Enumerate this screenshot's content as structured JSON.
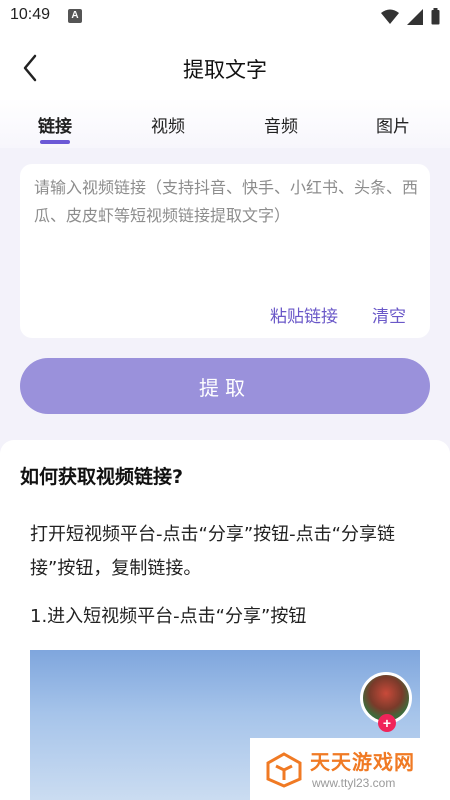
{
  "status_bar": {
    "time": "10:49",
    "notification_badge": "A",
    "icons": [
      "wifi-icon",
      "signal-icon",
      "battery-icon"
    ]
  },
  "header": {
    "title": "提取文字",
    "back_icon": "chevron-left-icon"
  },
  "tabs": [
    {
      "label": "链接",
      "active": true
    },
    {
      "label": "视频",
      "active": false
    },
    {
      "label": "音频",
      "active": false
    },
    {
      "label": "图片",
      "active": false
    }
  ],
  "input": {
    "placeholder": "请输入视频链接（支持抖音、快手、小红书、头条、西瓜、皮皮虾等短视频链接提取文字）",
    "value": "",
    "paste_label": "粘贴链接",
    "clear_label": "清空"
  },
  "extract_button": {
    "label": "提取"
  },
  "help": {
    "title": "如何获取视频链接?",
    "description": "打开短视频平台-点击“分享”按钮-点击“分享链接”按钮，复制链接。",
    "step1": "1.进入短视频平台-点击“分享”按钮",
    "follow_badge": "+"
  },
  "watermark": {
    "name": "天天游戏网",
    "url": "www.ttyl23.com"
  },
  "colors": {
    "accent": "#6b58d6",
    "button": "#9a91db",
    "link": "#6a58c8",
    "background": "#f3f2fa",
    "watermark": "#f07a24"
  }
}
